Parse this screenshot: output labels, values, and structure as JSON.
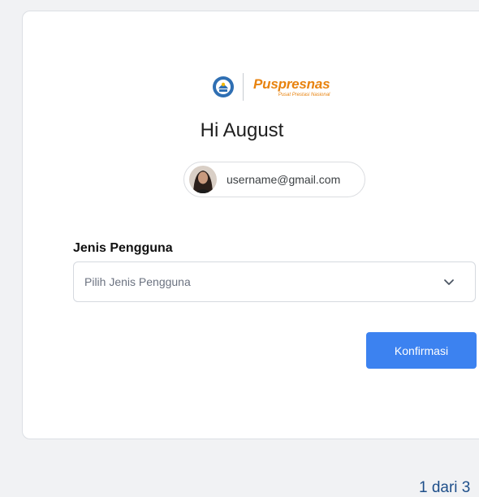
{
  "logo": {
    "name": "Puspresnas",
    "tagline": "Pusat Prestasi Nasional"
  },
  "greeting": "Hi August",
  "account": {
    "email": "username@gmail.com"
  },
  "form": {
    "user_type_label": "Jenis Pengguna",
    "user_type_placeholder": "Pilih Jenis Pengguna"
  },
  "actions": {
    "confirm_label": "Konfirmasi"
  },
  "pagination": {
    "text": "1 dari 3"
  },
  "colors": {
    "primary_button": "#3c82f0",
    "brand_orange": "#e8830f",
    "pager_text": "#1e4f8a"
  }
}
